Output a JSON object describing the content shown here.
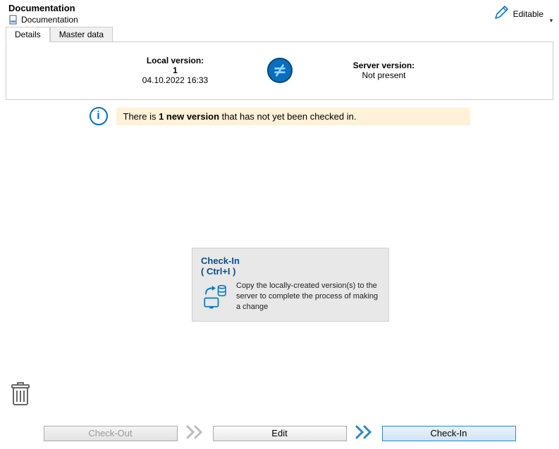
{
  "header": {
    "title": "Documentation",
    "subtitle": "Documentation",
    "editable_label": "Editable"
  },
  "tabs": {
    "details": "Details",
    "master_data": "Master data"
  },
  "versions": {
    "local_label": "Local version:",
    "local_value": "1",
    "local_date": "04.10.2022 16:33",
    "server_label": "Server version:",
    "server_value": "Not present"
  },
  "info": {
    "prefix": "There is ",
    "bold": "1 new version",
    "suffix": " that has not yet been checked in."
  },
  "tooltip": {
    "title": "Check-In",
    "shortcut": "( Ctrl+I )",
    "description": "Copy the locally-created version(s) to the server to complete the process of making a change"
  },
  "footer": {
    "check_out": "Check-Out",
    "edit": "Edit",
    "check_in": "Check-In"
  }
}
